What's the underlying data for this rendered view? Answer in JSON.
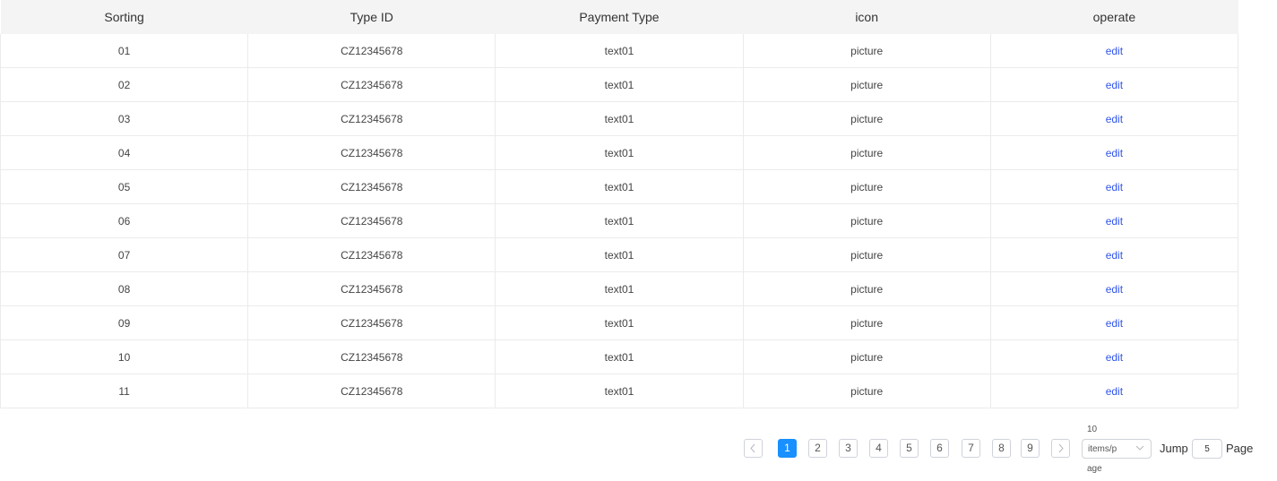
{
  "table": {
    "headers": [
      "Sorting",
      "Type ID",
      "Payment Type",
      "icon",
      "operate"
    ],
    "rows": [
      {
        "sorting": "01",
        "type_id": "CZ12345678",
        "payment_type": "text01",
        "icon": "picture",
        "operate": "edit"
      },
      {
        "sorting": "02",
        "type_id": "CZ12345678",
        "payment_type": "text01",
        "icon": "picture",
        "operate": "edit"
      },
      {
        "sorting": "03",
        "type_id": "CZ12345678",
        "payment_type": "text01",
        "icon": "picture",
        "operate": "edit"
      },
      {
        "sorting": "04",
        "type_id": "CZ12345678",
        "payment_type": "text01",
        "icon": "picture",
        "operate": "edit"
      },
      {
        "sorting": "05",
        "type_id": "CZ12345678",
        "payment_type": "text01",
        "icon": "picture",
        "operate": "edit"
      },
      {
        "sorting": "06",
        "type_id": "CZ12345678",
        "payment_type": "text01",
        "icon": "picture",
        "operate": "edit"
      },
      {
        "sorting": "07",
        "type_id": "CZ12345678",
        "payment_type": "text01",
        "icon": "picture",
        "operate": "edit"
      },
      {
        "sorting": "08",
        "type_id": "CZ12345678",
        "payment_type": "text01",
        "icon": "picture",
        "operate": "edit"
      },
      {
        "sorting": "09",
        "type_id": "CZ12345678",
        "payment_type": "text01",
        "icon": "picture",
        "operate": "edit"
      },
      {
        "sorting": "10",
        "type_id": "CZ12345678",
        "payment_type": "text01",
        "icon": "picture",
        "operate": "edit"
      },
      {
        "sorting": "11",
        "type_id": "CZ12345678",
        "payment_type": "text01",
        "icon": "picture",
        "operate": "edit"
      }
    ]
  },
  "pagination": {
    "prev_icon": "chevron-left-icon",
    "next_icon": "chevron-right-icon",
    "pages": [
      "1",
      "2",
      "3",
      "4",
      "5",
      "6",
      "7",
      "8",
      "9"
    ],
    "current_page": "1",
    "page_size": {
      "line1": "10",
      "line2": "items/p",
      "line3": "age",
      "dropdown_icon": "chevron-down-icon"
    },
    "jump_label": "Jump",
    "jump_value": "5",
    "page_label": "Page"
  },
  "colors": {
    "accent": "#1890ff",
    "link": "#2f54eb",
    "header_bg": "#f4f4f5",
    "border": "#ebebeb"
  }
}
